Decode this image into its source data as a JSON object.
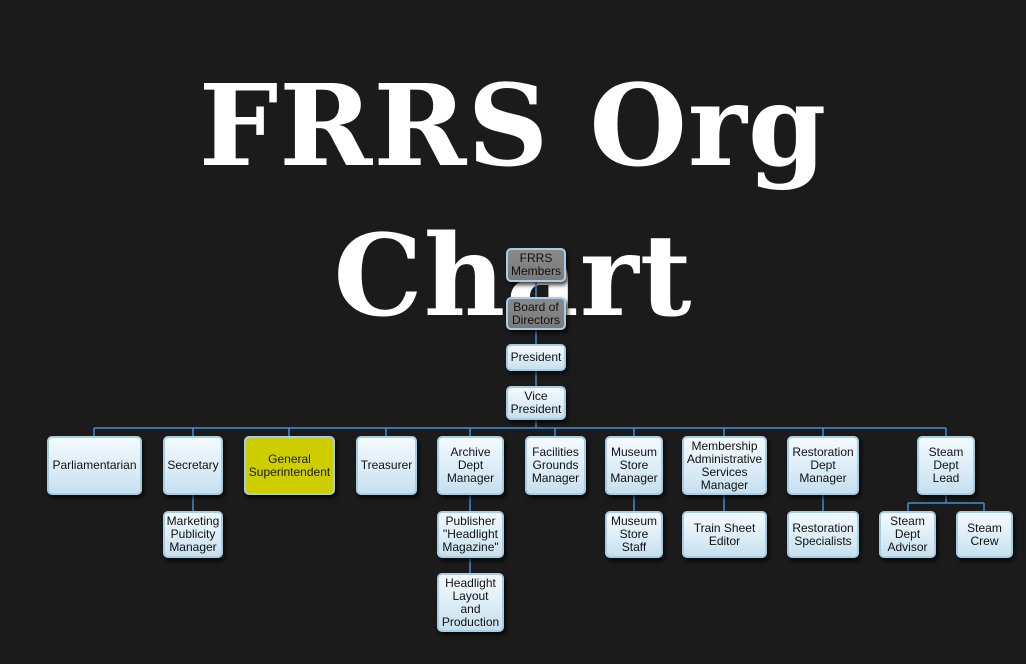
{
  "title": "FRRS Org Chart",
  "colors": {
    "background": "#1b1b1b",
    "connector": "#3f8fd8",
    "node_fill": "#e2f0f8",
    "node_border": "#a8cde3",
    "node_gray": "#7f7f7f",
    "node_highlight": "#cdcd00"
  },
  "nodes": {
    "frrs_members": "FRRS\nMembers",
    "board": "Board of\nDirectors",
    "president": "President",
    "vice_president": "Vice\nPresident",
    "parliamentarian": "Parliamentarian",
    "secretary": "Secretary",
    "marketing": "Marketing\nPublicity\nManager",
    "general_superintendent": "General\nSuperintendent",
    "treasurer": "Treasurer",
    "archive": "Archive\nDept\nManager",
    "publisher": "Publisher\n\"Headlight\nMagazine\"",
    "headlight_layout": "Headlight\nLayout\nand\nProduction",
    "facilities": "Facilities\nGrounds\nManager",
    "museum_store_manager": "Museum\nStore\nManager",
    "museum_store_staff": "Museum\nStore\nStaff",
    "membership": "Membership\nAdministrative\nServices\nManager",
    "train_sheet_editor": "Train Sheet\nEditor",
    "restoration_manager": "Restoration\nDept\nManager",
    "restoration_specialists": "Restoration\nSpecialists",
    "steam_lead": "Steam\nDept\nLead",
    "steam_advisor": "Steam\nDept\nAdvisor",
    "steam_crew": "Steam\nCrew"
  }
}
